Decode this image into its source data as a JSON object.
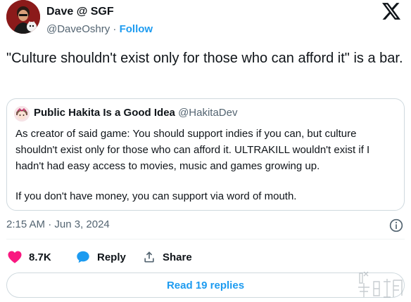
{
  "author": {
    "display_name": "Dave @ SGF",
    "handle": "@DaveOshry",
    "separator": "·",
    "follow_label": "Follow"
  },
  "tweet": {
    "text": "\"Culture shouldn't exist only for those who can afford it\" is a bar."
  },
  "quote": {
    "display_name": "Public Hakita Is a Good Idea",
    "handle": "@HakitaDev",
    "paragraph_1": "As creator of said game: You should support indies if you can, but culture shouldn't exist only for those who can afford it. ULTRAKILL wouldn't exist if I hadn't had easy access to movies, music and games growing up.",
    "paragraph_2": "If you don't have money, you can support via word of mouth."
  },
  "meta": {
    "timestamp": "2:15 AM · Jun 3, 2024"
  },
  "actions": {
    "likes": "8.7K",
    "reply_label": "Reply",
    "share_label": "Share"
  },
  "read_replies_label": "Read 19 replies",
  "icons": {
    "brand": "x-logo-icon",
    "like": "heart-icon",
    "reply": "speech-bubble-icon",
    "share": "share-upload-icon",
    "info": "info-icon"
  },
  "colors": {
    "accent": "#1d9bf0",
    "like": "#f91880",
    "secondary_text": "#536471",
    "border": "#cfd9de"
  }
}
